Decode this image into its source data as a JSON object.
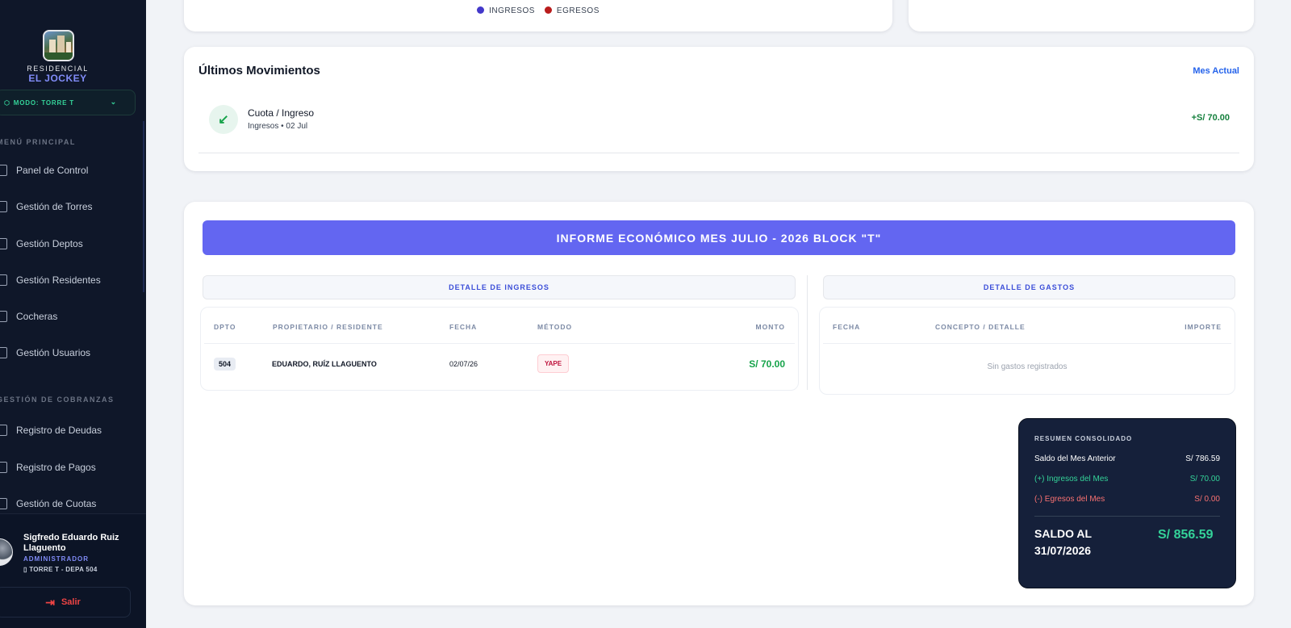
{
  "sidebar": {
    "brand_small": "RESIDENCIAL",
    "brand_big": "EL JOCKEY",
    "mode_label": "MODO: TORRE T",
    "section_main": "MENÚ PRINCIPAL",
    "section_collections": "GESTIÓN DE COBRANZAS",
    "items": [
      {
        "label": "Panel de Control"
      },
      {
        "label": "Gestión de Torres"
      },
      {
        "label": "Gestión Deptos"
      },
      {
        "label": "Gestión Residentes"
      },
      {
        "label": "Cocheras"
      },
      {
        "label": "Gestión Usuarios"
      },
      {
        "label": "Registro de Deudas"
      },
      {
        "label": "Registro de Pagos"
      },
      {
        "label": "Gestión de Cuotas"
      }
    ],
    "user": {
      "name": "Sigfredo Eduardo Ruiz Llaguento",
      "role": "ADMINISTRADOR",
      "location": "TORRE T - DEPA 504"
    },
    "logout_label": "Salir"
  },
  "chart_legend": [
    {
      "label": "INGRESOS",
      "color": "#4338ca"
    },
    {
      "label": "EGRESOS",
      "color": "#b91c1c"
    }
  ],
  "movements": {
    "title": "Últimos Movimientos",
    "link": "Mes Actual",
    "items": [
      {
        "title": "Cuota / Ingreso",
        "subtitle": "Ingresos • 02 Jul",
        "amount": "+S/ 70.00",
        "icon": "arrow-down-left-icon"
      }
    ]
  },
  "report": {
    "banner": "INFORME ECONÓMICO MES JULIO - 2026 BLOCK \"T\"",
    "income": {
      "title": "DETALLE DE INGRESOS",
      "headers": [
        "DPTO",
        "PROPIETARIO / RESIDENTE",
        "FECHA",
        "MÉTODO",
        "MONTO"
      ],
      "rows": [
        {
          "dpto": "504",
          "owner": "EDUARDO, RUÍZ LLAGUENTO",
          "date": "02/07/26",
          "method": "YAPE",
          "amount": "S/ 70.00"
        }
      ]
    },
    "expenses": {
      "title": "DETALLE DE GASTOS",
      "headers": [
        "FECHA",
        "CONCEPTO / DETALLE",
        "IMPORTE"
      ],
      "empty": "Sin gastos registrados"
    },
    "summary": {
      "title": "RESUMEN CONSOLIDADO",
      "prev_label": "Saldo del Mes Anterior",
      "prev_value": "S/ 786.59",
      "income_label": "(+) Ingresos del Mes",
      "income_value": "S/ 70.00",
      "expense_label": "(-) Egresos del Mes",
      "expense_value": "S/ 0.00",
      "total_label": "SALDO AL 31/07/2026",
      "total_value": "S/ 856.59"
    }
  },
  "colors": {
    "sidebar_bg": "#0f1729",
    "accent": "#6366f1",
    "income": "#16a34a",
    "expense": "#ef4444"
  }
}
